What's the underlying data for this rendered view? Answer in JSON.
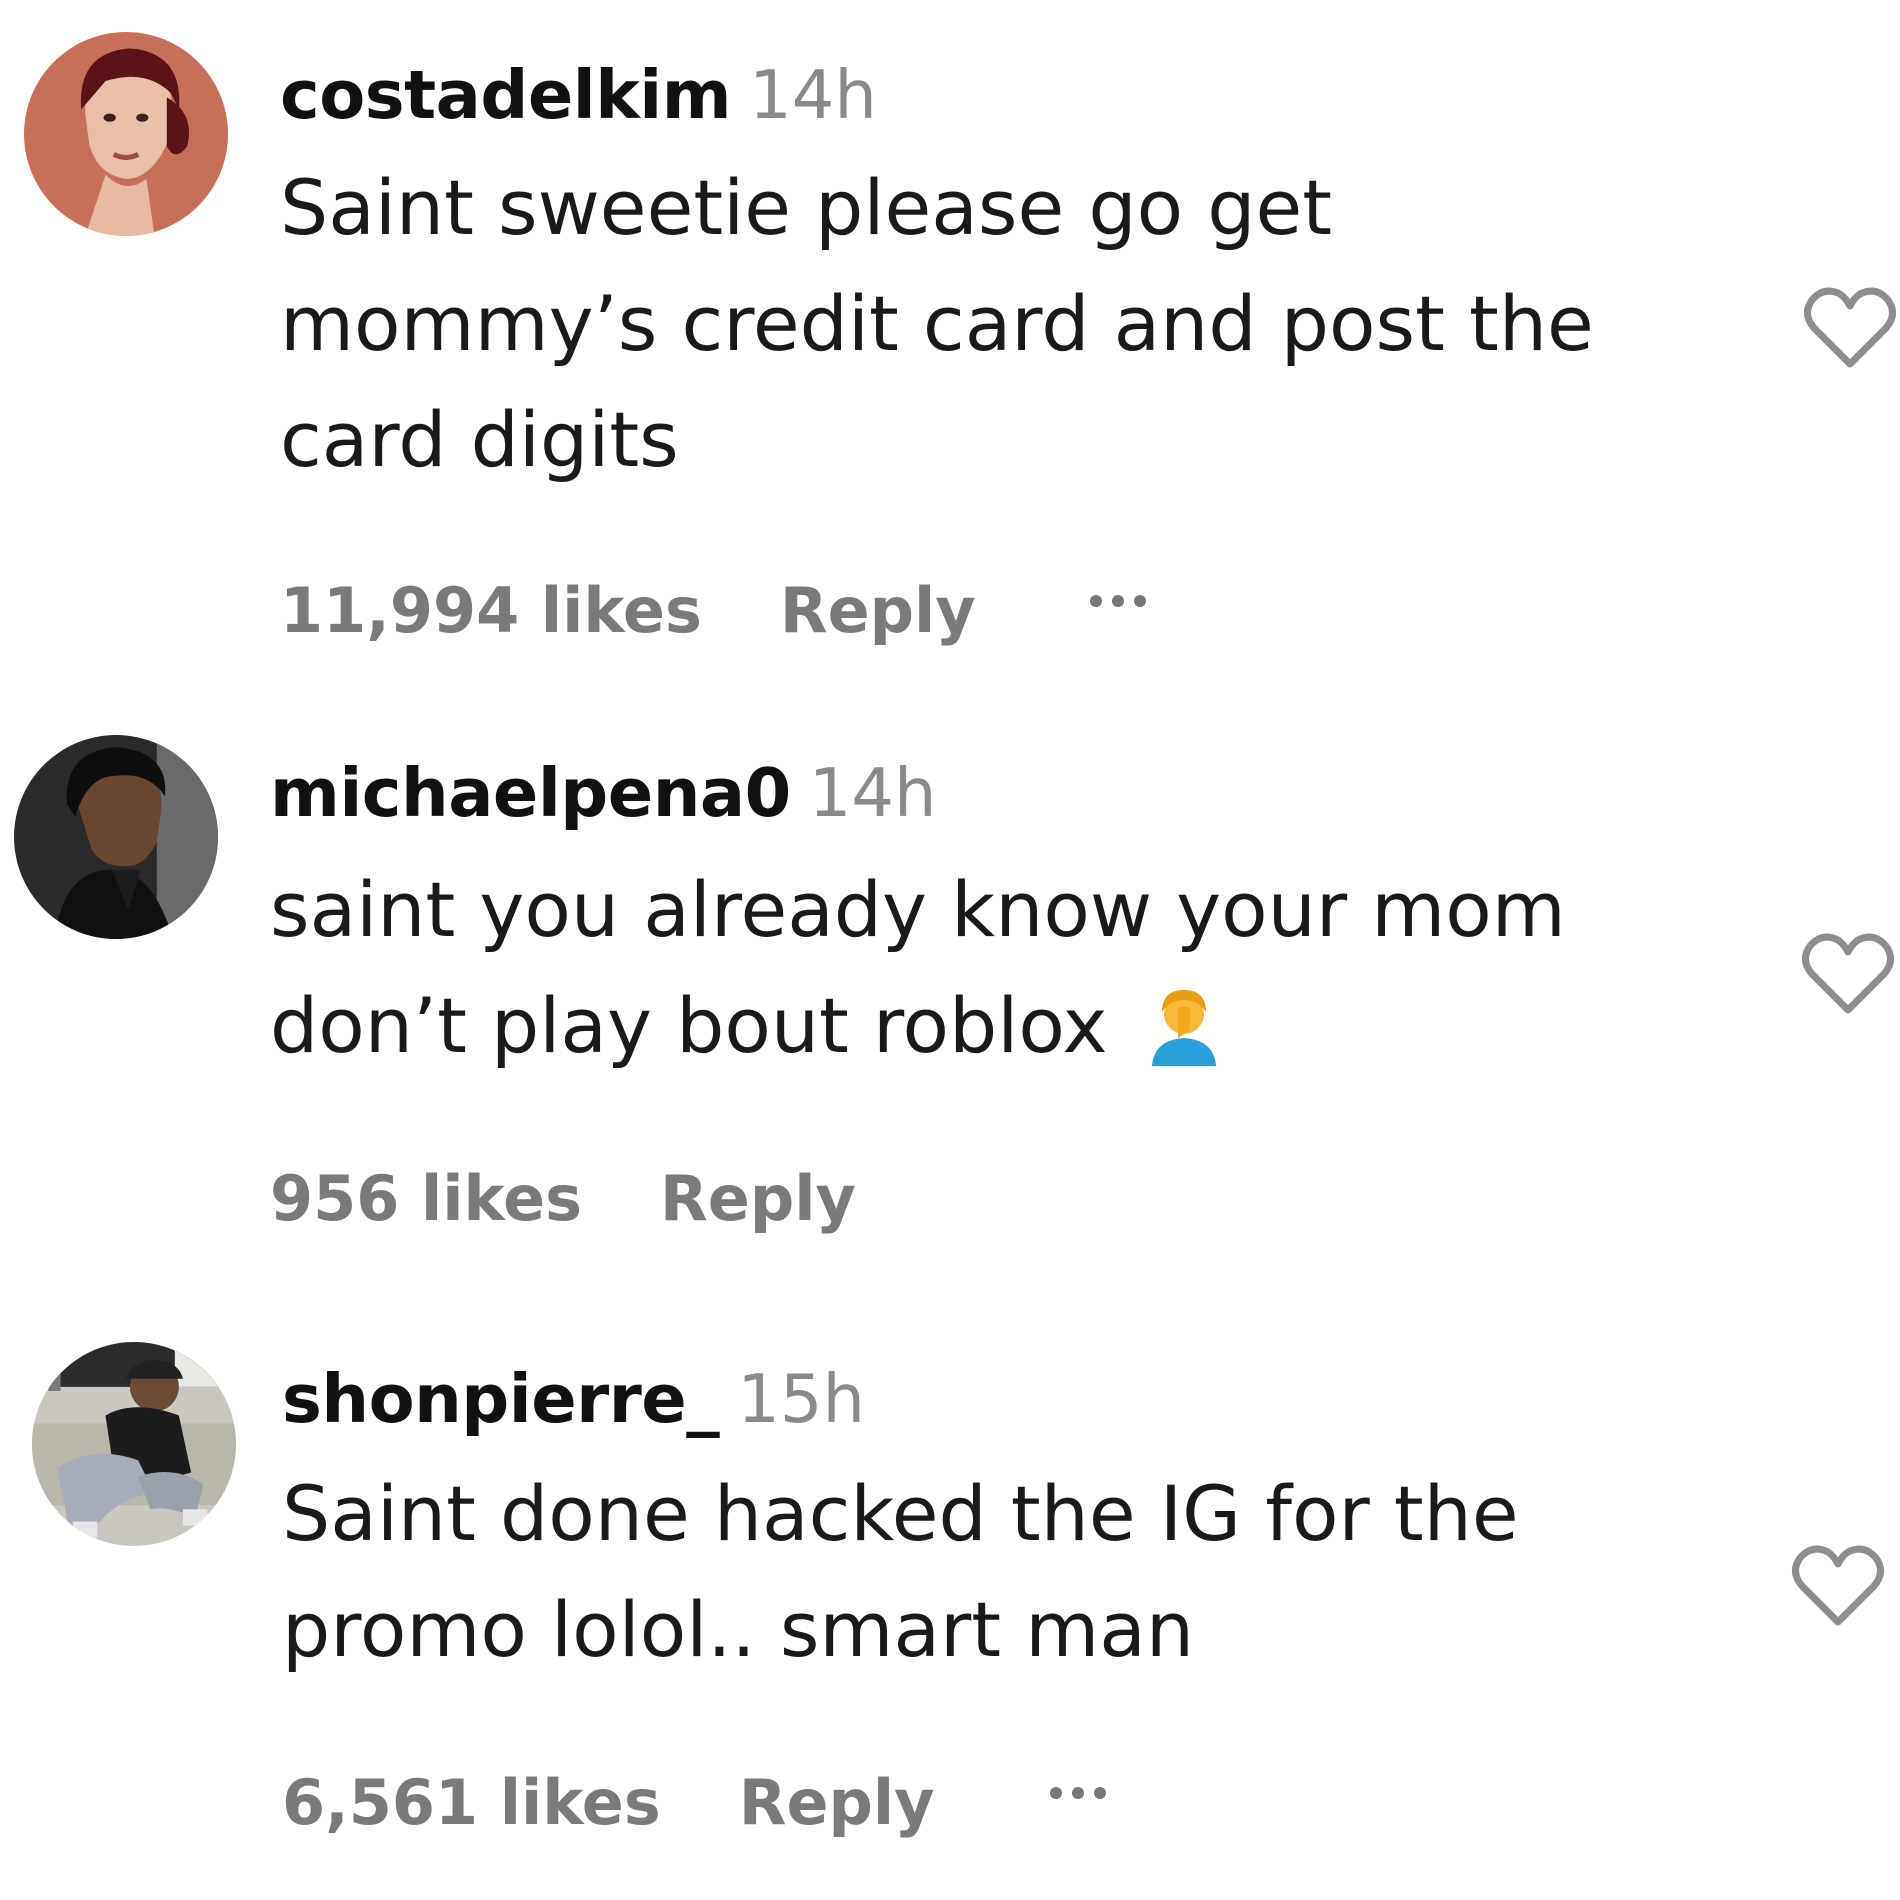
{
  "comments": [
    {
      "username": "costadelkim",
      "time": "14h",
      "text": "Saint sweetie please go get\nmommy’s credit card and post the\ncard digits",
      "likes": "11,994 likes",
      "reply": "Reply",
      "more_icon": "ellipsis-icon",
      "like_icon": "heart-outline-icon"
    },
    {
      "username": "michaelpena0",
      "time": "14h",
      "text": "saint you already know your mom\ndon’t play bout roblox",
      "emoji": "person-facepalming-emoji",
      "likes": "956 likes",
      "reply": "Reply",
      "like_icon": "heart-outline-icon"
    },
    {
      "username": "shonpierre_",
      "time": "15h",
      "text": "Saint done hacked the IG for the\npromo lolol.. smart man",
      "likes": "6,561 likes",
      "reply": "Reply",
      "more_icon": "ellipsis-icon",
      "like_icon": "heart-outline-icon"
    }
  ],
  "colors": {
    "username": "#111111",
    "timestamp": "#8a8a8a",
    "meta": "#7a7a7a",
    "heart_stroke": "#8e8e8e"
  }
}
